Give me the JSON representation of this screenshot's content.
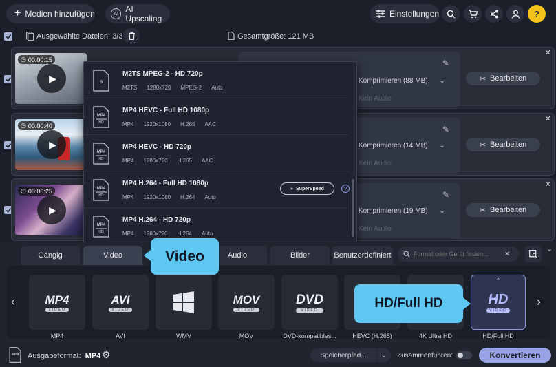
{
  "toolbar": {
    "add_media_label": "Medien hinzufügen",
    "ai_upscaling_label": "AI Upscaling",
    "settings_label": "Einstellungen"
  },
  "selection_bar": {
    "selected_label": "Ausgewählte Dateien:",
    "selected_count": "3/3",
    "total_size_label": "Gesamtgröße:",
    "total_size_value": "121 MB"
  },
  "files": [
    {
      "duration": "00:00:15",
      "compress": "Komprimieren (88 MB)",
      "audio": "Kein Audio",
      "edit_label": "Bearbeiten"
    },
    {
      "duration": "00:00:40",
      "compress": "Komprimieren (14 MB)",
      "audio": "Kein Audio",
      "edit_label": "Bearbeiten"
    },
    {
      "duration": "00:00:25",
      "compress": "Komprimieren (19 MB)",
      "audio": "Kein Audio",
      "edit_label": "Bearbeiten"
    }
  ],
  "preset_dropdown": {
    "items": [
      {
        "name": "M2TS MPEG-2 - HD 720p",
        "container": "M2TS",
        "resolution": "1280x720",
        "codec": "MPEG-2",
        "audio": "Auto",
        "icon": "bluray-icon"
      },
      {
        "name": "MP4 HEVC - Full HD 1080p",
        "container": "MP4",
        "resolution": "1920x1080",
        "codec": "H.265",
        "audio": "AAC",
        "icon": "mp4-hd-icon"
      },
      {
        "name": "MP4 HEVC - HD 720p",
        "container": "MP4",
        "resolution": "1280x720",
        "codec": "H.265",
        "audio": "AAC",
        "icon": "mp4-hd-icon"
      },
      {
        "name": "MP4 H.264 - Full HD 1080p",
        "container": "MP4",
        "resolution": "1920x1080",
        "codec": "H.264",
        "audio": "Auto",
        "icon": "mp4-hd-icon",
        "badge": "SuperSpeed"
      },
      {
        "name": "MP4 H.264 - HD 720p",
        "container": "MP4",
        "resolution": "1280x720",
        "codec": "H.264",
        "audio": "Auto",
        "icon": "mp4-hd-icon"
      }
    ]
  },
  "format_tabs": [
    "Gängig",
    "Video",
    "Audio",
    "Bilder",
    "Benutzerdefiniert"
  ],
  "format_search": {
    "placeholder": "Format oder Gerät finden..."
  },
  "formats": [
    {
      "logo": "MP4",
      "sub": "VIDEO",
      "label": "MP4"
    },
    {
      "logo": "AVI",
      "sub": "VIDEO",
      "label": "AVI"
    },
    {
      "logo": "",
      "sub": "",
      "label": "WMV"
    },
    {
      "logo": "MOV",
      "sub": "VIDEO",
      "label": "MOV"
    },
    {
      "logo": "DVD",
      "sub": "VIDEO",
      "label": "DVD-kompatibles..."
    },
    {
      "logo": "",
      "sub": "",
      "label": "HEVC (H.265)"
    },
    {
      "logo": "",
      "sub": "",
      "label": "4K Ultra HD"
    },
    {
      "logo": "HD",
      "sub": "VIDEO",
      "label": "HD/Full HD"
    }
  ],
  "callouts": {
    "video": "Video",
    "hd": "HD/Full HD"
  },
  "bottom_bar": {
    "output_format_label": "Ausgabeformat:",
    "output_format_value": "MP4",
    "save_path_label": "Speicherpfad...",
    "merge_label": "Zusammenführen:",
    "convert_label": "Konvertieren"
  },
  "colors": {
    "accent": "#9aa3e6",
    "callout": "#5fc8f2",
    "background": "#1b1f29"
  }
}
